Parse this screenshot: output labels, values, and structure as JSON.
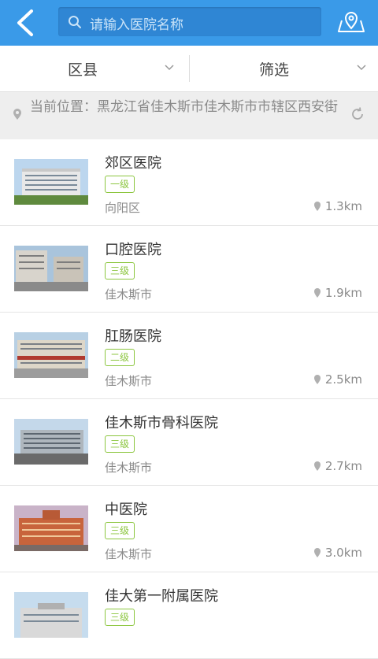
{
  "header": {
    "back_icon": "chevron-left-icon",
    "search_placeholder": "请输入医院名称",
    "map_icon": "map-pin-icon",
    "bg_color": "#3a9ae8"
  },
  "filters": {
    "district_label": "区县",
    "filter_label": "筛选"
  },
  "location": {
    "text": "当前位置：黑龙江省佳木斯市佳木斯市市辖区西安街"
  },
  "hospitals": [
    {
      "name": "郊区医院",
      "level": "一级",
      "district": "向阳区",
      "distance": "1.3km"
    },
    {
      "name": "口腔医院",
      "level": "三级",
      "district": "佳木斯市",
      "distance": "1.9km"
    },
    {
      "name": "肛肠医院",
      "level": "二级",
      "district": "佳木斯市",
      "distance": "2.5km"
    },
    {
      "name": "佳木斯市骨科医院",
      "level": "三级",
      "district": "佳木斯市",
      "distance": "2.7km"
    },
    {
      "name": "中医院",
      "level": "三级",
      "district": "佳木斯市",
      "distance": "3.0km"
    },
    {
      "name": "佳大第一附属医院",
      "level": "三级",
      "district": "",
      "distance": ""
    }
  ],
  "colors": {
    "accent": "#3a9ae8",
    "badge": "#8cc63f"
  }
}
